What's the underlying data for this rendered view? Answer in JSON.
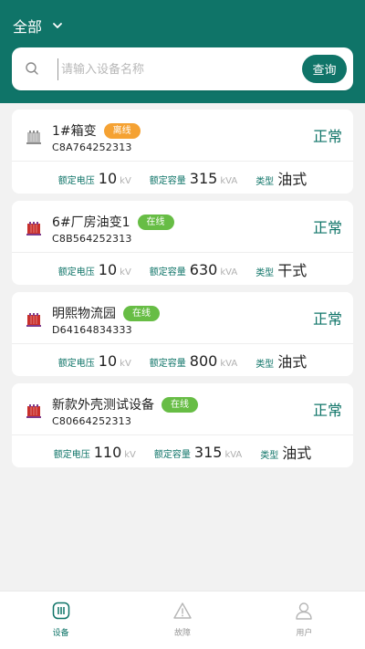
{
  "header": {
    "filter_label": "全部",
    "search_placeholder": "请输入设备名称",
    "search_button": "查询"
  },
  "labels": {
    "voltage": "额定电压",
    "capacity": "额定容量",
    "type": "类型"
  },
  "devices": [
    {
      "name": "1#箱变",
      "badge": "离线",
      "badge_color": "#f5a233",
      "code": "C8A764252313",
      "status": "正常",
      "voltage": "10",
      "voltage_unit": "kV",
      "capacity": "315",
      "capacity_unit": "kVA",
      "type": "油式",
      "icon": "transformer-gray-icon"
    },
    {
      "name": "6#厂房油变1",
      "badge": "在线",
      "badge_color": "#67bd45",
      "code": "C8B564252313",
      "status": "正常",
      "voltage": "10",
      "voltage_unit": "kV",
      "capacity": "630",
      "capacity_unit": "kVA",
      "type": "干式",
      "icon": "transformer-red-icon"
    },
    {
      "name": "明熙物流园",
      "badge": "在线",
      "badge_color": "#67bd45",
      "code": "D64164834333",
      "status": "正常",
      "voltage": "10",
      "voltage_unit": "kV",
      "capacity": "800",
      "capacity_unit": "kVA",
      "type": "油式",
      "icon": "transformer-red-icon"
    },
    {
      "name": "新款外壳测试设备",
      "badge": "在线",
      "badge_color": "#67bd45",
      "code": "C80664252313",
      "status": "正常",
      "voltage": "110",
      "voltage_unit": "kV",
      "capacity": "315",
      "capacity_unit": "kVA",
      "type": "油式",
      "icon": "transformer-red-icon"
    }
  ],
  "tabs": [
    {
      "label": "设备",
      "icon": "device-icon",
      "active": true
    },
    {
      "label": "故障",
      "icon": "warning-icon",
      "active": false
    },
    {
      "label": "用户",
      "icon": "user-icon",
      "active": false
    }
  ],
  "colors": {
    "primary": "#0f7468",
    "offline": "#f5a233",
    "online": "#67bd45"
  }
}
